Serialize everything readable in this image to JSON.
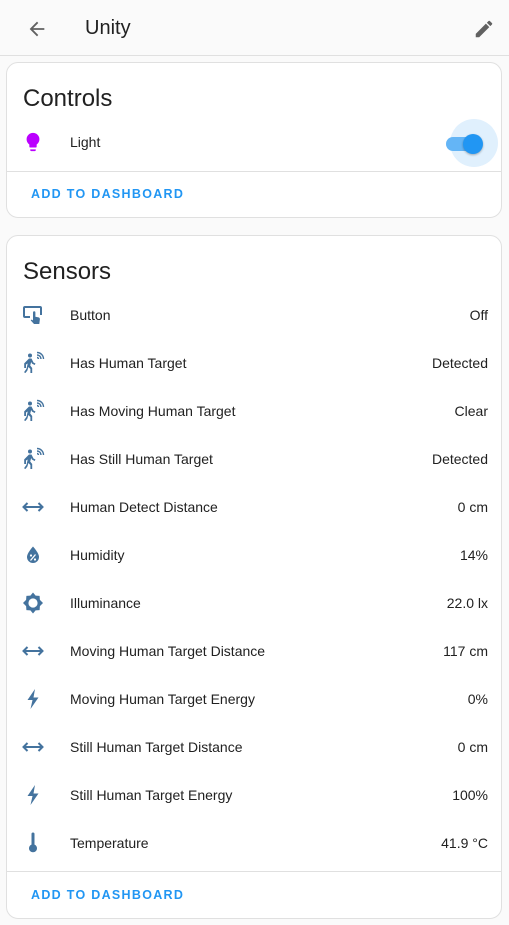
{
  "header": {
    "title": "Unity",
    "back_icon": "arrow-left-icon",
    "edit_icon": "pencil-icon"
  },
  "controls": {
    "title": "Controls",
    "items": [
      {
        "label": "Light",
        "icon": "lightbulb-icon",
        "state": "on"
      }
    ],
    "action": "ADD TO DASHBOARD"
  },
  "sensors": {
    "title": "Sensors",
    "items": [
      {
        "label": "Button",
        "value": "Off",
        "icon": "gesture-tap-button-icon"
      },
      {
        "label": "Has Human Target",
        "value": "Detected",
        "icon": "motion-sensor-icon"
      },
      {
        "label": "Has Moving Human Target",
        "value": "Clear",
        "icon": "motion-sensor-icon"
      },
      {
        "label": "Has Still Human Target",
        "value": "Detected",
        "icon": "motion-sensor-icon"
      },
      {
        "label": "Human Detect Distance",
        "value": "0 cm",
        "icon": "arrow-left-right-icon"
      },
      {
        "label": "Humidity",
        "value": "14%",
        "icon": "water-percent-icon"
      },
      {
        "label": "Illuminance",
        "value": "22.0 lx",
        "icon": "brightness-icon"
      },
      {
        "label": "Moving Human Target Distance",
        "value": "117 cm",
        "icon": "arrow-left-right-icon"
      },
      {
        "label": "Moving Human Target Energy",
        "value": "0%",
        "icon": "flash-icon"
      },
      {
        "label": "Still Human Target Distance",
        "value": "0 cm",
        "icon": "arrow-left-right-icon"
      },
      {
        "label": "Still Human Target Energy",
        "value": "100%",
        "icon": "flash-icon"
      },
      {
        "label": "Temperature",
        "value": "41.9 °C",
        "icon": "thermometer-icon"
      }
    ],
    "action": "ADD TO DASHBOARD"
  },
  "colors": {
    "accent": "#2196f3",
    "light_icon": "#bb00ff",
    "state_icon": "#44739e"
  }
}
